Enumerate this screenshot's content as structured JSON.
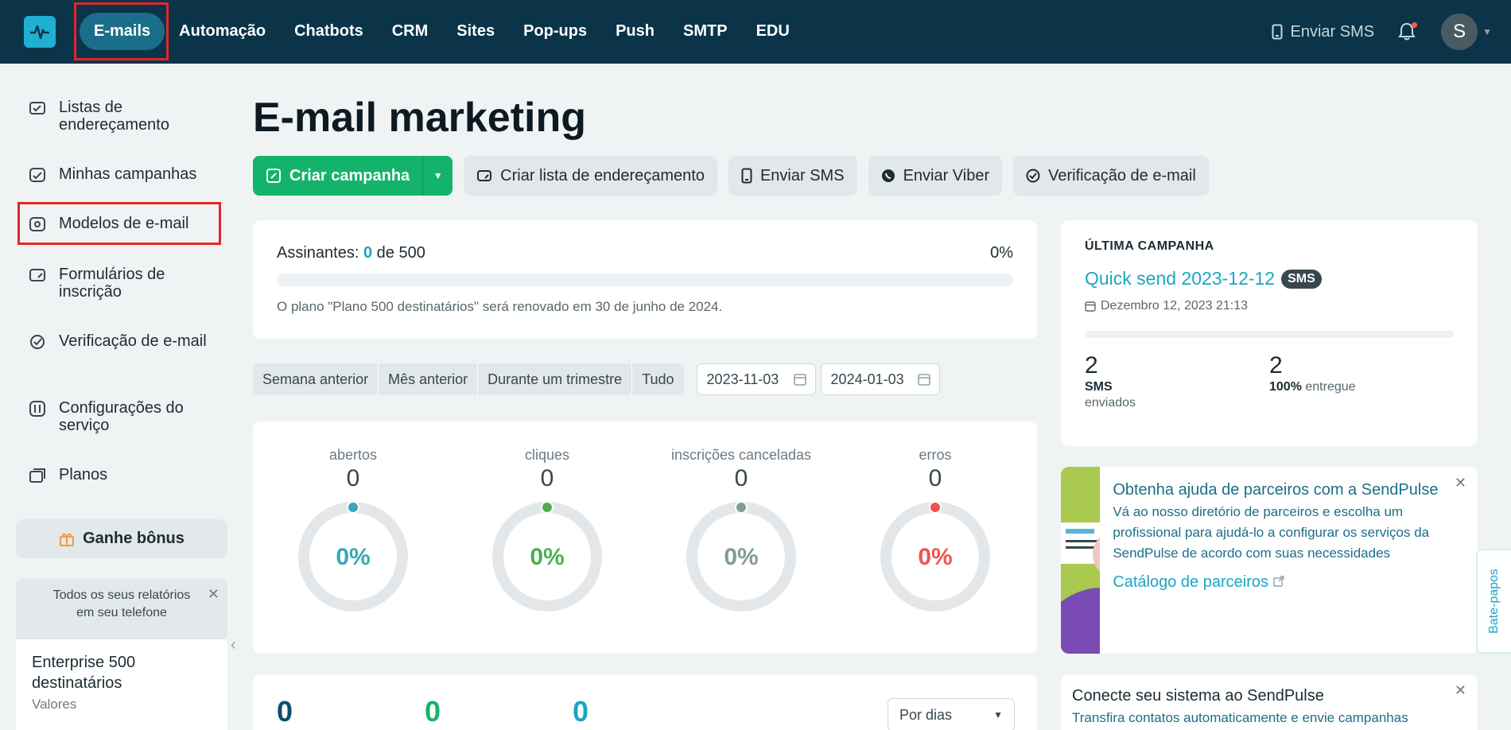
{
  "nav": {
    "items": [
      "E-mails",
      "Automação",
      "Chatbots",
      "CRM",
      "Sites",
      "Pop-ups",
      "Push",
      "SMTP",
      "EDU"
    ],
    "send_sms": "Enviar SMS",
    "avatar_letter": "S"
  },
  "sidebar": {
    "items": [
      {
        "label": "Listas de endereçamento",
        "icon": "address-list-icon"
      },
      {
        "label": "Minhas campanhas",
        "icon": "campaigns-icon"
      },
      {
        "label": "Modelos de e-mail",
        "icon": "templates-icon"
      },
      {
        "label": "Formulários de inscrição",
        "icon": "form-icon"
      },
      {
        "label": "Verificação de e-mail",
        "icon": "check-icon"
      },
      {
        "label": "Configurações do serviço",
        "icon": "settings-icon"
      },
      {
        "label": "Planos",
        "icon": "plans-icon"
      }
    ],
    "bonus": "Ganhe bônus",
    "promo_text": "Todos os seus relatórios em seu telefone",
    "plan_title": "Enterprise 500 destinatários",
    "plan_sub": "Valores"
  },
  "main": {
    "title": "E-mail marketing",
    "actions": {
      "create_campaign": "Criar campanha",
      "create_list": "Criar lista de endereçamento",
      "send_sms": "Enviar SMS",
      "send_viber": "Enviar Viber",
      "verify": "Verificação de e-mail"
    },
    "subscribers": {
      "label": "Assinantes:",
      "count": "0",
      "of": "de 500",
      "percent": "0%",
      "note": "O plano \"Plano 500 destinatários\" será renovado em 30 de junho de 2024."
    },
    "filters": {
      "periods": [
        "Semana anterior",
        "Mês anterior",
        "Durante um trimestre",
        "Tudo"
      ],
      "date_from": "2023-11-03",
      "date_to": "2024-01-03"
    },
    "stats": [
      {
        "label": "abertos",
        "value": "0",
        "percent": "0%",
        "color": "#35a9b8"
      },
      {
        "label": "cliques",
        "value": "0",
        "percent": "0%",
        "color": "#4caf50"
      },
      {
        "label": "inscrições canceladas",
        "value": "0",
        "percent": "0%",
        "color": "#7f9c98"
      },
      {
        "label": "erros",
        "value": "0",
        "percent": "0%",
        "color": "#ef5350"
      }
    ],
    "bottom_counts": [
      {
        "value": "0",
        "color": "#0b4f6c"
      },
      {
        "value": "0",
        "color": "#14b36b"
      },
      {
        "value": "0",
        "color": "#1aa6c4"
      }
    ],
    "group_by": "Por dias"
  },
  "last_campaign": {
    "caption": "ÚLTIMA CAMPANHA",
    "name": "Quick send 2023-12-12",
    "badge": "SMS",
    "date": "Dezembro 12, 2023 21:13",
    "sent_value": "2",
    "sent_label_1": "SMS",
    "sent_label_2": "enviados",
    "delivered_value": "2",
    "delivered_pct": "100%",
    "delivered_label": "entregue"
  },
  "partners": {
    "title": "Obtenha ajuda de parceiros com a SendPulse",
    "text": "Vá ao nosso diretório de parceiros e escolha um profissional para ajudá-lo a configurar os serviços da SendPulse de acordo com suas necessidades",
    "link": "Catálogo de parceiros"
  },
  "connect": {
    "title": "Conecte seu sistema ao SendPulse",
    "text": "Transfira contatos automaticamente e envie campanhas"
  },
  "chat_tab": "Bate-papos"
}
